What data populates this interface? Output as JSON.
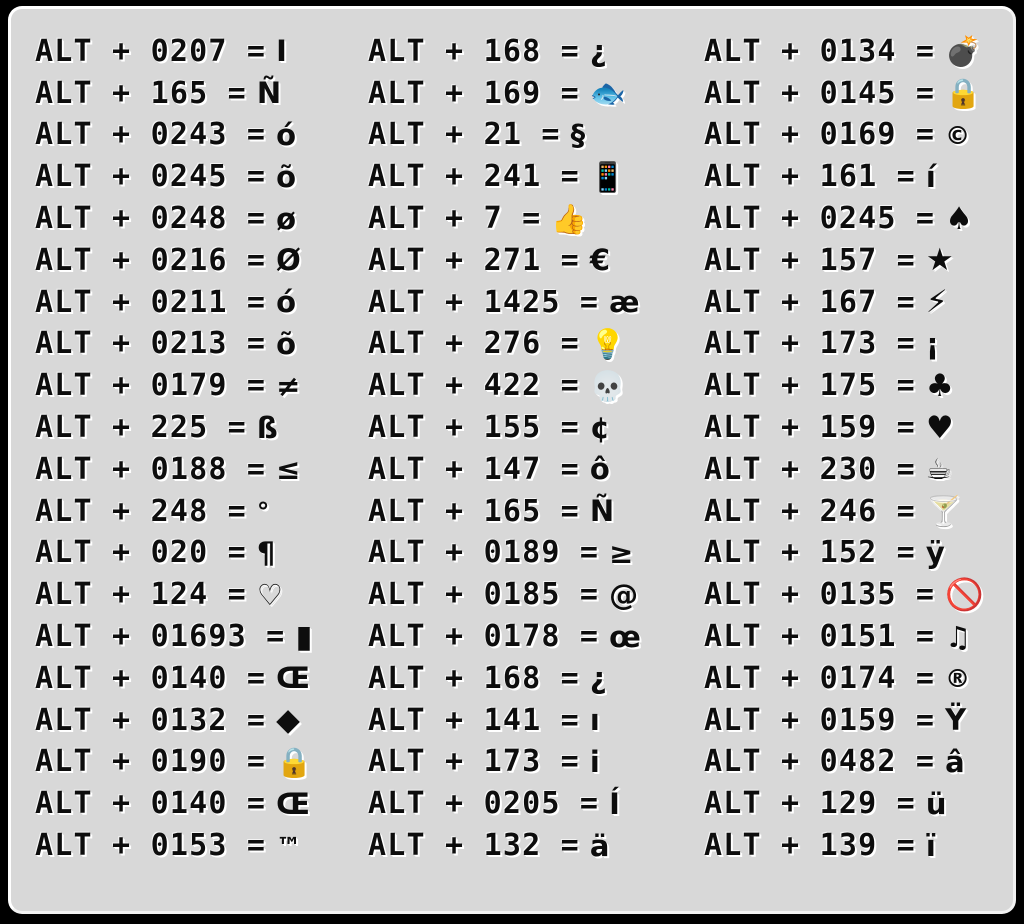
{
  "page": {
    "title": "ALT codes reference chart",
    "background_color": "#000000",
    "panel_color": "#d8d8d8",
    "text_color": "#0d0d0d",
    "highlight_color": "#ffffff"
  },
  "columns": [
    {
      "name": "column-1",
      "rows": [
        {
          "prefix": "ALT + 0207 =",
          "code": "0207",
          "symbol": "I",
          "symbol_name": "latin-capital-i"
        },
        {
          "prefix": "ALT + 165 =",
          "code": "165",
          "symbol": "Ñ",
          "symbol_name": "latin-capital-n-tilde"
        },
        {
          "prefix": "ALT + 0243 =",
          "code": "0243",
          "symbol": "ó",
          "symbol_name": "latin-small-o-acute"
        },
        {
          "prefix": "ALT + 0245 =",
          "code": "0245",
          "symbol": "õ",
          "symbol_name": "latin-small-o-tilde"
        },
        {
          "prefix": "ALT + 0248 =",
          "code": "0248",
          "symbol": "ø",
          "symbol_name": "latin-small-o-stroke"
        },
        {
          "prefix": "ALT + 0216 =",
          "code": "0216",
          "symbol": "Ø",
          "symbol_name": "latin-capital-o-stroke"
        },
        {
          "prefix": "ALT + 0211 =",
          "code": "0211",
          "symbol": "ó",
          "symbol_name": "latin-small-o-acute"
        },
        {
          "prefix": "ALT + 0213 =",
          "code": "0213",
          "symbol": "õ",
          "symbol_name": "latin-small-o-breve"
        },
        {
          "prefix": "ALT + 0179 =",
          "code": "0179",
          "symbol": "≠",
          "symbol_name": "not-equal-sign"
        },
        {
          "prefix": "ALT + 225 =",
          "code": "225",
          "symbol": "ß",
          "symbol_name": "latin-small-sharp-s"
        },
        {
          "prefix": "ALT + 0188 =",
          "code": "0188",
          "symbol": "≤",
          "symbol_name": "less-than-or-equal-sign"
        },
        {
          "prefix": "ALT + 248 =",
          "code": "248",
          "symbol": "°",
          "symbol_name": "degree-sign"
        },
        {
          "prefix": "ALT + 020 =",
          "code": "020",
          "symbol": "¶",
          "symbol_name": "pilcrow-sign"
        },
        {
          "prefix": "ALT + 124 =",
          "code": "124",
          "symbol": "♡",
          "symbol_name": "white-heart"
        },
        {
          "prefix": "ALT + 01693 =",
          "code": "01693",
          "symbol": "▮",
          "symbol_name": "filled-bar"
        },
        {
          "prefix": "ALT + 0140 =",
          "code": "0140",
          "symbol": "Œ",
          "symbol_name": "latin-capital-ligature-oe"
        },
        {
          "prefix": "ALT + 0132 =",
          "code": "0132",
          "symbol": "◆",
          "symbol_name": "black-diamond"
        },
        {
          "prefix": "ALT + 0190 =",
          "code": "0190",
          "symbol": "🔒",
          "symbol_name": "lock-icon"
        },
        {
          "prefix": "ALT + 0140 =",
          "code": "0140",
          "symbol": "Œ",
          "symbol_name": "latin-capital-ligature-oe"
        },
        {
          "prefix": "ALT + 0153 =",
          "code": "0153",
          "symbol": "™",
          "symbol_name": "trade-mark-sign"
        }
      ]
    },
    {
      "name": "column-2",
      "rows": [
        {
          "prefix": "ALT + 168 =",
          "code": "168",
          "symbol": "¿",
          "symbol_name": "inverted-question-mark"
        },
        {
          "prefix": "ALT + 169 =",
          "code": "169",
          "symbol": "🐟",
          "symbol_name": "fish-icon"
        },
        {
          "prefix": "ALT + 21 =",
          "code": "21",
          "symbol": "§",
          "symbol_name": "section-sign"
        },
        {
          "prefix": "ALT + 241 =",
          "code": "241",
          "symbol": "📱",
          "symbol_name": "mobile-phone-icon"
        },
        {
          "prefix": "ALT + 7 =",
          "code": "7",
          "symbol": "👍",
          "symbol_name": "thumbs-up-icon"
        },
        {
          "prefix": "ALT + 271 =",
          "code": "271",
          "symbol": "€",
          "symbol_name": "euro-sign"
        },
        {
          "prefix": "ALT + 1425 =",
          "code": "1425",
          "symbol": "æ",
          "symbol_name": "latin-small-ligature-ae"
        },
        {
          "prefix": "ALT + 276 =",
          "code": "276",
          "symbol": "💡",
          "symbol_name": "light-bulb-icon"
        },
        {
          "prefix": "ALT + 422 =",
          "code": "422",
          "symbol": "💀",
          "symbol_name": "skull-icon"
        },
        {
          "prefix": "ALT + 155 =",
          "code": "155",
          "symbol": "¢",
          "symbol_name": "cent-sign"
        },
        {
          "prefix": "ALT + 147 =",
          "code": "147",
          "symbol": "ô",
          "symbol_name": "latin-small-o-circumflex"
        },
        {
          "prefix": "ALT + 165 =",
          "code": "165",
          "symbol": "Ñ",
          "symbol_name": "latin-capital-n-tilde"
        },
        {
          "prefix": "ALT + 0189 =",
          "code": "0189",
          "symbol": "≥",
          "symbol_name": "greater-than-or-equal-sign"
        },
        {
          "prefix": "ALT + 0185 =",
          "code": "0185",
          "symbol": "@",
          "symbol_name": "at-sign-spiral"
        },
        {
          "prefix": "ALT + 0178 =",
          "code": "0178",
          "symbol": "œ",
          "symbol_name": "latin-small-ligature-oe"
        },
        {
          "prefix": "ALT + 168 =",
          "code": "168",
          "symbol": "¿",
          "symbol_name": "inverted-question-mark"
        },
        {
          "prefix": "ALT + 141 =",
          "code": "141",
          "symbol": "ı",
          "symbol_name": "latin-small-dotless-i"
        },
        {
          "prefix": "ALT + 173 =",
          "code": "173",
          "symbol": "i",
          "symbol_name": "latin-small-i"
        },
        {
          "prefix": "ALT + 0205 =",
          "code": "0205",
          "symbol": "Í",
          "symbol_name": "latin-capital-i-acute"
        },
        {
          "prefix": "ALT + 132 =",
          "code": "132",
          "symbol": "ä",
          "symbol_name": "latin-small-a-diaeresis"
        }
      ]
    },
    {
      "name": "column-3",
      "rows": [
        {
          "prefix": "ALT + 0134 =",
          "code": "0134",
          "symbol": "💣",
          "symbol_name": "bomb-icon"
        },
        {
          "prefix": "ALT + 0145 =",
          "code": "0145",
          "symbol": "🔒",
          "symbol_name": "lock-icon"
        },
        {
          "prefix": "ALT + 0169 =",
          "code": "0169",
          "symbol": "©",
          "symbol_name": "copyright-sign"
        },
        {
          "prefix": "ALT + 161 =",
          "code": "161",
          "symbol": "í",
          "symbol_name": "latin-small-i-acute"
        },
        {
          "prefix": "ALT + 0245 =",
          "code": "0245",
          "symbol": "♠",
          "symbol_name": "black-spade-suit"
        },
        {
          "prefix": "ALT + 157 =",
          "code": "157",
          "symbol": "★",
          "symbol_name": "black-star"
        },
        {
          "prefix": "ALT + 167 =",
          "code": "167",
          "symbol": "⚡",
          "symbol_name": "lightning-bolt-icon"
        },
        {
          "prefix": "ALT + 173 =",
          "code": "173",
          "symbol": "¡",
          "symbol_name": "inverted-exclamation-mark"
        },
        {
          "prefix": "ALT + 175 =",
          "code": "175",
          "symbol": "♣",
          "symbol_name": "black-club-suit"
        },
        {
          "prefix": "ALT + 159 =",
          "code": "159",
          "symbol": "♥",
          "symbol_name": "black-heart-suit"
        },
        {
          "prefix": "ALT + 230 =",
          "code": "230",
          "symbol": "☕",
          "symbol_name": "hot-beverage-icon"
        },
        {
          "prefix": "ALT + 246 =",
          "code": "246",
          "symbol": "🍸",
          "symbol_name": "cocktail-glass-icon"
        },
        {
          "prefix": "ALT + 152 =",
          "code": "152",
          "symbol": "ÿ",
          "symbol_name": "latin-small-y-diaeresis"
        },
        {
          "prefix": "ALT + 0135 =",
          "code": "0135",
          "symbol": "🚫",
          "symbol_name": "no-entry-icon"
        },
        {
          "prefix": "ALT + 0151 =",
          "code": "0151",
          "symbol": "♫",
          "symbol_name": "beamed-eighth-notes"
        },
        {
          "prefix": "ALT + 0174 =",
          "code": "0174",
          "symbol": "®",
          "symbol_name": "registered-sign"
        },
        {
          "prefix": "ALT + 0159 =",
          "code": "0159",
          "symbol": "Ÿ",
          "symbol_name": "latin-capital-y-diaeresis"
        },
        {
          "prefix": "ALT + 0482 =",
          "code": "0482",
          "symbol": "â",
          "symbol_name": "latin-small-a-circumflex"
        },
        {
          "prefix": "ALT + 129 =",
          "code": "129",
          "symbol": "ü",
          "symbol_name": "latin-small-u-diaeresis"
        },
        {
          "prefix": "ALT + 139 =",
          "code": "139",
          "symbol": "ï",
          "symbol_name": "latin-small-i-diaeresis"
        }
      ]
    }
  ]
}
